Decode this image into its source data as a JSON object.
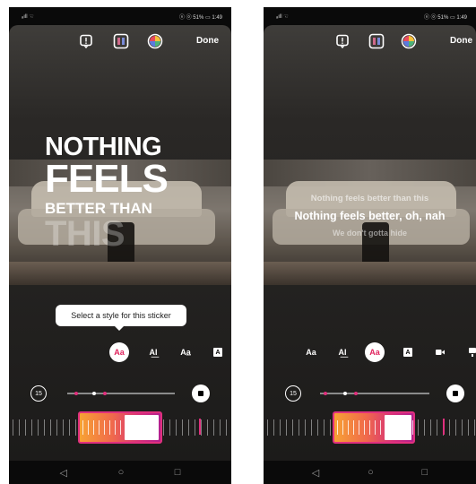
{
  "status": {
    "signal": "ₐıll ☜",
    "right": "ⓝ ⓞ 51% ▭ 1:49"
  },
  "topbar": {
    "done_label": "Done",
    "icons": [
      "alert-sticker-icon",
      "text-style-icon",
      "color-wheel-icon"
    ]
  },
  "left_screen": {
    "caption_lines": [
      "NOTHING",
      "FEELS",
      "BETTER THAN",
      "THIS"
    ],
    "tooltip": "Select a style for this sticker",
    "styles": [
      "Aa",
      "A͟I",
      "Aa̲",
      "A"
    ],
    "timer": "15"
  },
  "right_screen": {
    "lyric_lines": [
      "Nothing feels better than this",
      "Nothing feels better, oh, nah",
      "We don't gotta hide"
    ],
    "styles": [
      "Aa",
      "A͟I",
      "Aa",
      "A"
    ],
    "timer": "15"
  },
  "nav": {
    "back": "◁",
    "home": "○",
    "recents": "□"
  },
  "colors": {
    "accent_pink": "#e0307e",
    "accent_orange": "#f7a234"
  }
}
